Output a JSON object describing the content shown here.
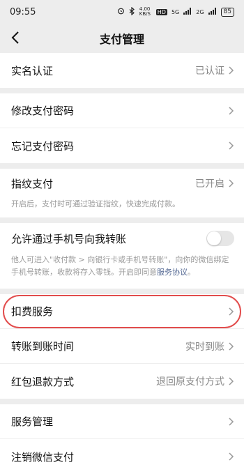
{
  "status_bar": {
    "time": "09:55",
    "speed": "4.00 KB/S",
    "hd": "HD",
    "signal_1": "5G",
    "signal_2": "2G",
    "battery": "85"
  },
  "nav": {
    "title": "支付管理"
  },
  "rows": {
    "real_name": {
      "label": "实名认证",
      "value": "已认证"
    },
    "change_password": {
      "label": "修改支付密码"
    },
    "forgot_password": {
      "label": "忘记支付密码"
    },
    "fingerprint": {
      "label": "指纹支付",
      "value": "已开启",
      "desc": "开启后，支付时可通过验证指纹，快速完成付款。"
    },
    "phone_transfer": {
      "label": "允许通过手机号向我转账",
      "desc": "他人可进入\"收付款 > 向银行卡或手机号转账\"，向你的微信绑定手机号转账，收款将存入零钱。开启即同意",
      "desc_link": "服务协议",
      "desc_end": "。",
      "enabled": false
    },
    "deduction": {
      "label": "扣费服务"
    },
    "arrival_time": {
      "label": "转账到账时间",
      "value": "实时到账"
    },
    "red_packet_refund": {
      "label": "红包退款方式",
      "value": "退回原支付方式"
    },
    "service_manage": {
      "label": "服务管理"
    },
    "cancel_wechat_pay": {
      "label": "注销微信支付"
    }
  },
  "colors": {
    "background": "#ededed",
    "link": "#576b95",
    "highlight": "#e24d4d"
  }
}
